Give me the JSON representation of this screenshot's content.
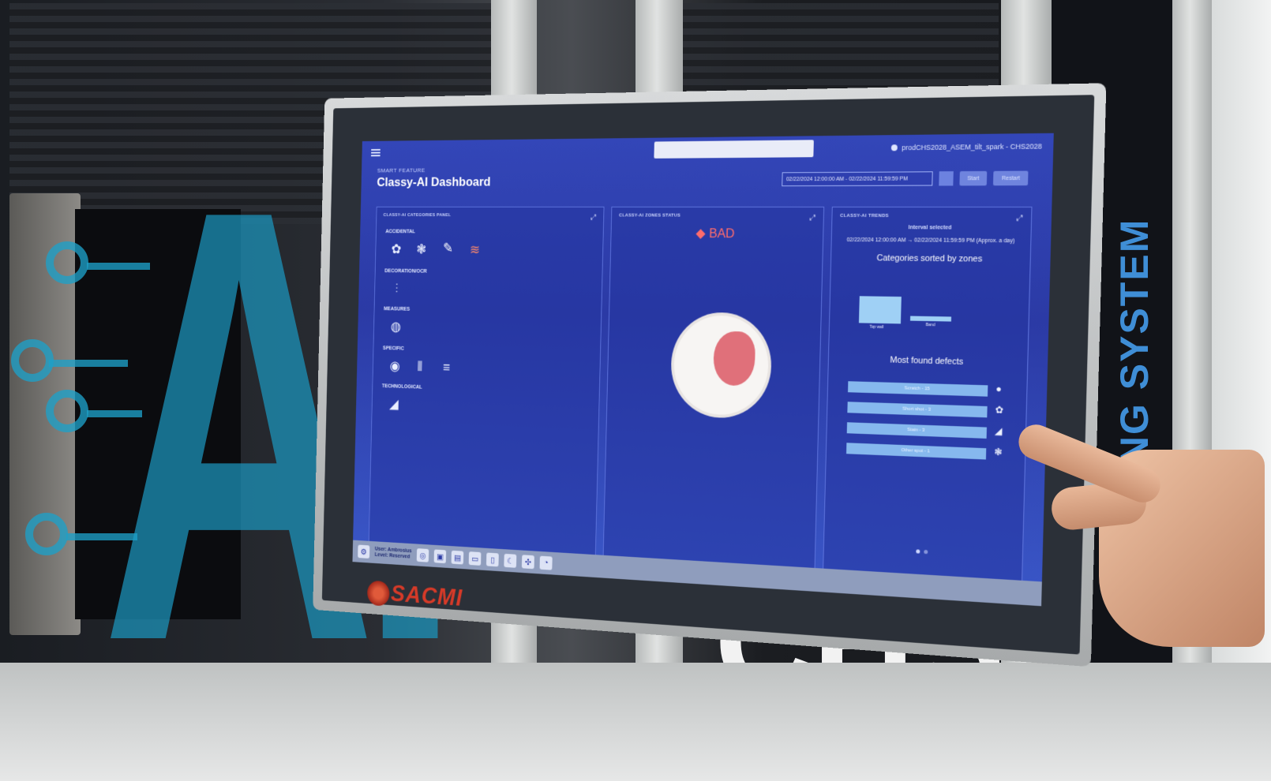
{
  "scene": {
    "wall_text": "HANDLING SYSTEM",
    "machine_logo": "CHS",
    "overlay_text": "AI",
    "brand": "SACMI"
  },
  "topbar": {
    "user_label": "prodCHS2028_ASEM_tilt_spark - CHS2028"
  },
  "header": {
    "eyebrow": "SMART FEATURE",
    "title": "Classy-AI Dashboard",
    "date_range": "02/22/2024 12:00:00 AM - 02/22/2024 11:59:59 PM",
    "start_label": "Start",
    "restart_label": "Restart"
  },
  "panels": {
    "categories": {
      "title": "CLASSY-AI CATEGORIES PANEL",
      "sections": [
        {
          "label": "ACCIDENTAL",
          "icons": [
            "chip-icon",
            "puzzle-icon",
            "crack-icon",
            "wave-icon"
          ],
          "active_index": 2
        },
        {
          "label": "DECORATION/OCR",
          "icons": [
            "sliders-icon"
          ]
        },
        {
          "label": "MEASURES",
          "icons": [
            "ellipse-icon"
          ]
        },
        {
          "label": "SPECIFIC",
          "icons": [
            "disc-icon",
            "barcode-icon",
            "lines-icon"
          ]
        },
        {
          "label": "TECHNOLOGICAL",
          "icons": [
            "fin-icon"
          ]
        }
      ]
    },
    "zones": {
      "title": "CLASSY-AI ZONES STATUS",
      "status": "BAD",
      "status_color": "#ff6c6c"
    },
    "trends": {
      "title": "CLASSY-AI TRENDS",
      "interval_label": "Interval selected",
      "interval_value": "02/22/2024 12:00:00 AM → 02/22/2024 11:59:59 PM (Approx. a day)",
      "zones_title": "Categories sorted by zones",
      "zone_labels": [
        "Top wall",
        "Band"
      ],
      "defects_title": "Most found defects",
      "defects": [
        {
          "label": "Scratch - 15",
          "icon": "circle-icon"
        },
        {
          "label": "Short shot - 3",
          "icon": "chip-icon"
        },
        {
          "label": "Stain - 3",
          "icon": "fin-icon"
        },
        {
          "label": "Other spot - 1",
          "icon": "puzzle-icon"
        }
      ]
    }
  },
  "footer": {
    "user_line1": "User: Ambrosius",
    "user_line2": "Level: Reserved"
  },
  "colors": {
    "screen_bg": "#2f42b3",
    "accent_bar": "#86b8ee",
    "overlay_ai": "#1c96be",
    "brand_red": "#d63a28"
  }
}
